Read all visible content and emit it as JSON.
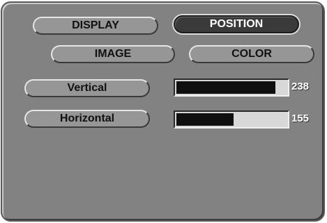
{
  "tabs": {
    "display": "DISPLAY",
    "position": "POSITION",
    "image": "IMAGE",
    "color": "COLOR"
  },
  "active_tab": "POSITION",
  "settings": [
    {
      "label": "Vertical",
      "value": "238",
      "level_fraction": 0.9
    },
    {
      "label": "Horizontal",
      "value": "155",
      "level_fraction": 0.52
    }
  ],
  "colors": {
    "panel": "#828282",
    "button": "#969696",
    "active_button": "#3a3a3a",
    "bar_track": "#d8d8d8",
    "bar_fill": "#0f0f0f",
    "value_text": "#ffffff"
  }
}
